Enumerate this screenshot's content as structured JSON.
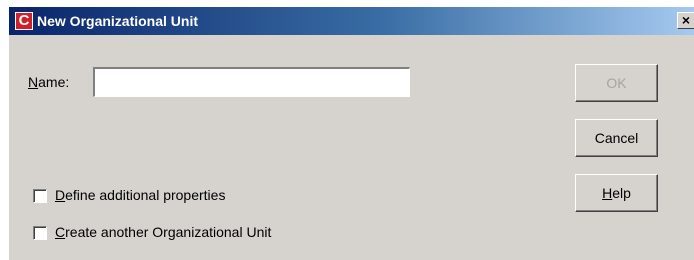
{
  "window": {
    "title": "New Organizational Unit",
    "app_icon_letter": "C",
    "close_symbol": "×"
  },
  "form": {
    "name_label_mnemonic": "N",
    "name_label_rest": "ame:",
    "name_value": "",
    "define_props_mnemonic": "D",
    "define_props_rest": "efine additional properties",
    "define_props_checked": false,
    "create_another_mnemonic": "C",
    "create_another_rest": "reate another Organizational Unit",
    "create_another_checked": false
  },
  "buttons": {
    "ok_label": "OK",
    "ok_enabled": false,
    "cancel_label": "Cancel",
    "help_mnemonic": "H",
    "help_rest": "elp"
  },
  "colors": {
    "dialog_bg": "#d6d3ce",
    "titlebar_start": "#0a246a",
    "titlebar_end": "#a6caf0",
    "app_icon": "#d0202a",
    "disabled_text": "#a7a49e"
  }
}
